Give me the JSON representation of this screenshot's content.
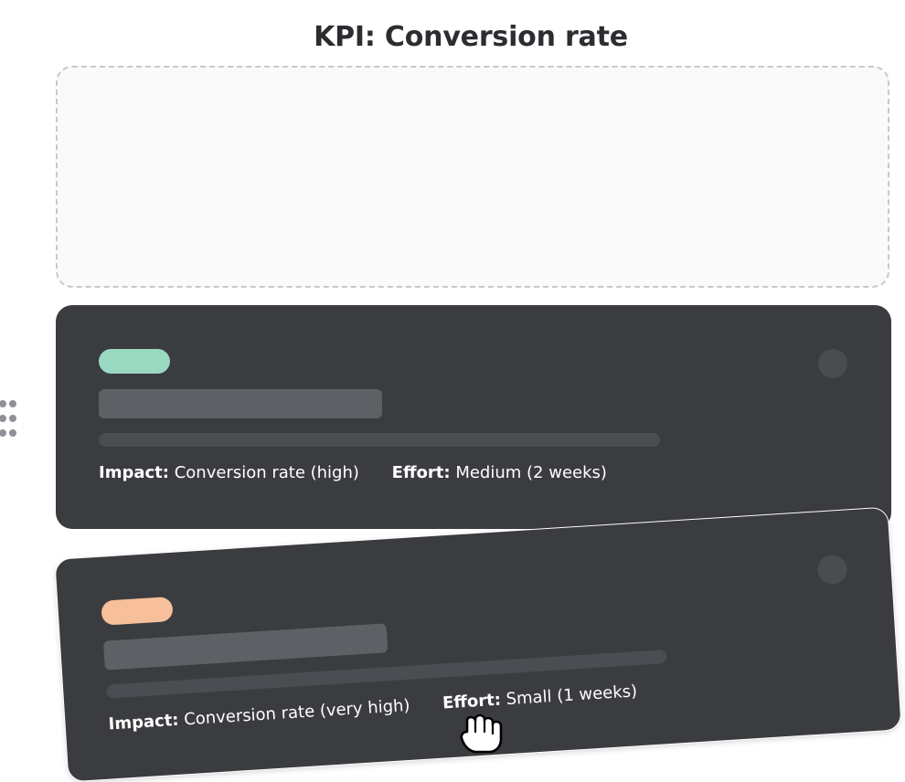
{
  "page": {
    "title": "KPI: Conversion rate"
  },
  "colors": {
    "card_background": "#3a3c40",
    "tag_green": "#9bd8c2",
    "tag_orange": "#f7c09a",
    "title_text": "#2b2d31"
  },
  "drop_zone": {
    "state": "empty-drop-target"
  },
  "cards": [
    {
      "tag_color": "#9bd8c2",
      "impact_label": "Impact:",
      "impact_value": "Conversion rate (high)",
      "effort_label": "Effort:",
      "effort_value": "Medium (2 weeks)"
    },
    {
      "tag_color": "#f7c09a",
      "impact_label": "Impact:",
      "impact_value": "Conversion rate (very high)",
      "effort_label": "Effort:",
      "effort_value": "Small (1 weeks)",
      "state": "being-dragged"
    }
  ],
  "icons": {
    "drag_handle": "drag-handle-icon",
    "cursor": "grab-cursor-icon"
  }
}
